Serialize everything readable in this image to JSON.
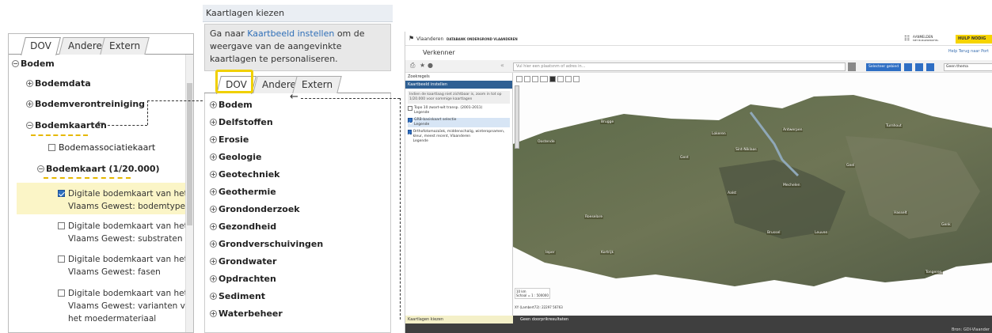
{
  "left_panel": {
    "tabs": [
      "DOV",
      "Andere",
      "Extern"
    ],
    "tree": {
      "root": "Bodem",
      "items": [
        "Bodemdata",
        "Bodemverontreiniging",
        "Bodemkaarten",
        "Bodemassociatiekaart",
        "Bodemkaart (1/20.000)"
      ],
      "layers": [
        {
          "line1": "Digitale bodemkaart van het",
          "line2": "Vlaams Gewest: bodemtypes",
          "line3": "",
          "checked": true
        },
        {
          "line1": "Digitale bodemkaart van het",
          "line2": "Vlaams Gewest: substraten",
          "line3": "",
          "checked": false
        },
        {
          "line1": "Digitale bodemkaart van het",
          "line2": "Vlaams Gewest: fasen",
          "line3": "",
          "checked": false
        },
        {
          "line1": "Digitale bodemkaart van het",
          "line2": "Vlaams Gewest: varianten van",
          "line3": "het moedermateriaal",
          "checked": false
        }
      ]
    },
    "highlight_color": "#fbf5c7",
    "accent_dash_color": "#e6b800"
  },
  "middle_panel": {
    "title": "Kaartlagen kiezen",
    "info_before": "Ga naar ",
    "info_link": "Kaartbeeld instellen",
    "info_after": " om de weergave van de aangevinkte kaartlagen te personaliseren.",
    "tabs": [
      "DOV",
      "Andere",
      "Extern"
    ],
    "items": [
      "Bodem",
      "Delfstoffen",
      "Erosie",
      "Geologie",
      "Geotechniek",
      "Geothermie",
      "Grondonderzoek",
      "Gezondheid",
      "Grondverschuivingen",
      "Grondwater",
      "Opdrachten",
      "Sediment",
      "Waterbeheer"
    ],
    "highlight_box_color": "#f0d000"
  },
  "app": {
    "brand": "Vlaanderen",
    "subtitle": "DATABANK ONDERGROND VLAANDEREN",
    "section": "Verkenner",
    "aanmelden": "AANMELDEN",
    "aanmelden_sub": "MET BURGERPROFIEL",
    "help_btn": "HULP NODIG",
    "links": "Help  Terug naar Port",
    "search_placeholder": "Vul hier een plaatsnm of adres in...",
    "select_area": "Selecteer gebied",
    "theme": "Geen thema",
    "sidebar_title": "Zoekregels",
    "sidebar_head": "Kaartbeeld instellen",
    "note": "Indien de kaartlaag niet zichtbaar is, zoom in tot op 1/20.000 voor sommige kaartlagen",
    "layers": [
      {
        "name": "Topo 10 zwart-wit transp. (2001-2011)",
        "legend": "Legende",
        "checked": false
      },
      {
        "name": "GRB-basiskaart selectie",
        "legend": "Legende",
        "checked": true
      },
      {
        "name": "Orthofotomozaïek, middenschalig, winteropnamen, kleur, meest recent, Vlaanderen",
        "legend": "Legende",
        "checked": true
      }
    ],
    "scale_text": "Schaal = 1 : 500000",
    "scale_km": "10 km",
    "coords": "XY (Lambert72): 22297 56763",
    "bottom_left": "Kaartlagen kiezen",
    "bottom_results": "Geen doorprikresultaten",
    "bottom_source": "Bron: GDI-Vlaander",
    "places": [
      "Brugge",
      "Gent",
      "Antwerpen",
      "Mechelen",
      "Leuven",
      "Hasselt",
      "Genk",
      "Aalst",
      "Kortrijk",
      "Ieper",
      "Roeselare",
      "Oostende",
      "Turnhout",
      "Sint-Niklaas",
      "Brussel",
      "Tongeren",
      "Geel",
      "Lokeren"
    ],
    "brand_blue": "#2f6fc4",
    "help_yellow": "#f6d400"
  }
}
